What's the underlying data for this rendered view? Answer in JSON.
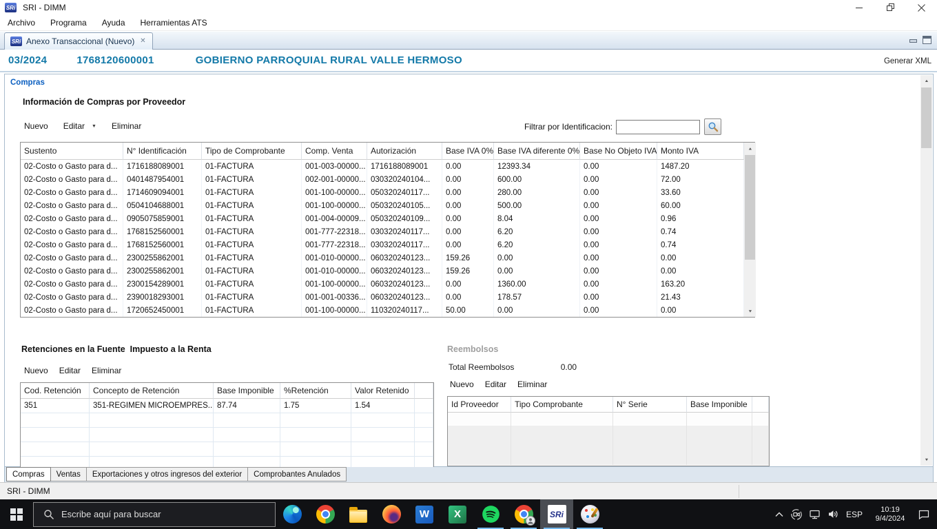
{
  "window": {
    "app_title": "SRI - DIMM",
    "menu_items": [
      "Archivo",
      "Programa",
      "Ayuda",
      "Herramientas ATS"
    ],
    "tab_label": "Anexo Transaccional (Nuevo)"
  },
  "doc_header": {
    "period": "03/2024",
    "ruc": "1768120600001",
    "entity": "GOBIERNO PARROQUIAL RURAL VALLE HERMOSO",
    "generate_xml_label": "Generar XML"
  },
  "compras": {
    "section_label": "Compras",
    "title": "Información de Compras por Proveedor",
    "actions": {
      "nuevo": "Nuevo",
      "editar": "Editar",
      "eliminar": "Eliminar"
    },
    "filter_label": "Filtrar por Identificacion:",
    "filter_value": "",
    "grid": {
      "columns": [
        "Sustento",
        "N° Identificación",
        "Tipo de Comprobante",
        "Comp. Venta",
        "Autorización",
        "Base IVA 0%",
        "Base IVA diferente 0%",
        "Base No Objeto IVA",
        "Monto IVA"
      ],
      "rows": [
        [
          "02-Costo o Gasto para d...",
          "1716188089001",
          "01-FACTURA",
          "001-003-00000...",
          "1716188089001",
          "0.00",
          "12393.34",
          "0.00",
          "1487.20"
        ],
        [
          "02-Costo o Gasto para d...",
          "0401487954001",
          "01-FACTURA",
          "002-001-00000...",
          "030320240104...",
          "0.00",
          "600.00",
          "0.00",
          "72.00"
        ],
        [
          "02-Costo o Gasto para d...",
          "1714609094001",
          "01-FACTURA",
          "001-100-00000...",
          "050320240117...",
          "0.00",
          "280.00",
          "0.00",
          "33.60"
        ],
        [
          "02-Costo o Gasto para d...",
          "0504104688001",
          "01-FACTURA",
          "001-100-00000...",
          "050320240105...",
          "0.00",
          "500.00",
          "0.00",
          "60.00"
        ],
        [
          "02-Costo o Gasto para d...",
          "0905075859001",
          "01-FACTURA",
          "001-004-00009...",
          "050320240109...",
          "0.00",
          "8.04",
          "0.00",
          "0.96"
        ],
        [
          "02-Costo o Gasto para d...",
          "1768152560001",
          "01-FACTURA",
          "001-777-22318...",
          "030320240117...",
          "0.00",
          "6.20",
          "0.00",
          "0.74"
        ],
        [
          "02-Costo o Gasto para d...",
          "1768152560001",
          "01-FACTURA",
          "001-777-22318...",
          "030320240117...",
          "0.00",
          "6.20",
          "0.00",
          "0.74"
        ],
        [
          "02-Costo o Gasto para d...",
          "2300255862001",
          "01-FACTURA",
          "001-010-00000...",
          "060320240123...",
          "159.26",
          "0.00",
          "0.00",
          "0.00"
        ],
        [
          "02-Costo o Gasto para d...",
          "2300255862001",
          "01-FACTURA",
          "001-010-00000...",
          "060320240123...",
          "159.26",
          "0.00",
          "0.00",
          "0.00"
        ],
        [
          "02-Costo o Gasto para d...",
          "2300154289001",
          "01-FACTURA",
          "001-100-00000...",
          "060320240123...",
          "0.00",
          "1360.00",
          "0.00",
          "163.20"
        ],
        [
          "02-Costo o Gasto para d...",
          "2390018293001",
          "01-FACTURA",
          "001-001-00336...",
          "060320240123...",
          "0.00",
          "178.57",
          "0.00",
          "21.43"
        ],
        [
          "02-Costo o Gasto para d...",
          "1720652450001",
          "01-FACTURA",
          "001-100-00000...",
          "110320240117...",
          "50.00",
          "0.00",
          "0.00",
          "0.00"
        ]
      ]
    }
  },
  "retenciones": {
    "title": "Retenciones en la Fuente  Impuesto a la Renta",
    "actions": {
      "nuevo": "Nuevo",
      "editar": "Editar",
      "eliminar": "Eliminar"
    },
    "columns": [
      "Cod. Retención",
      "Concepto de Retención",
      "Base Imponible",
      "%Retención",
      "Valor Retenido"
    ],
    "rows": [
      [
        "351",
        "351-REGIMEN MICROEMPRES...",
        "87.74",
        "1.75",
        "1.54"
      ]
    ]
  },
  "reembolsos": {
    "title": "Reembolsos",
    "total_label": "Total Reembolsos",
    "total_value": "0.00",
    "actions": {
      "nuevo": "Nuevo",
      "editar": "Editar",
      "eliminar": "Eliminar"
    },
    "columns": [
      "Id Proveedor",
      "Tipo Comprobante",
      "N° Serie",
      "Base Imponible"
    ],
    "rows": []
  },
  "bottom_tabs": {
    "tabs": [
      "Compras",
      "Ventas",
      "Exportaciones y otros ingresos del exterior",
      "Comprobantes Anulados"
    ],
    "active": "Compras"
  },
  "status_bar": {
    "text": "SRI - DIMM"
  },
  "taskbar": {
    "search_placeholder": "Escribe aquí para buscar",
    "apps": [
      "edge",
      "chrome",
      "file-explorer",
      "firefox",
      "word",
      "excel",
      "spotify",
      "chrome-profile",
      "sri-dimm",
      "paint"
    ],
    "tray": {
      "language": "ESP",
      "time": "10:19",
      "date": "9/4/2024"
    }
  },
  "icons": {
    "sri_logo_text": "SRi"
  },
  "colors": {
    "header_teal": "#1379A8",
    "section_blue": "#0B5FC0",
    "taskbar_underline": "#76B9ED",
    "sri_logo_blue": "#26348B",
    "taskbar_bg": "#101114"
  }
}
